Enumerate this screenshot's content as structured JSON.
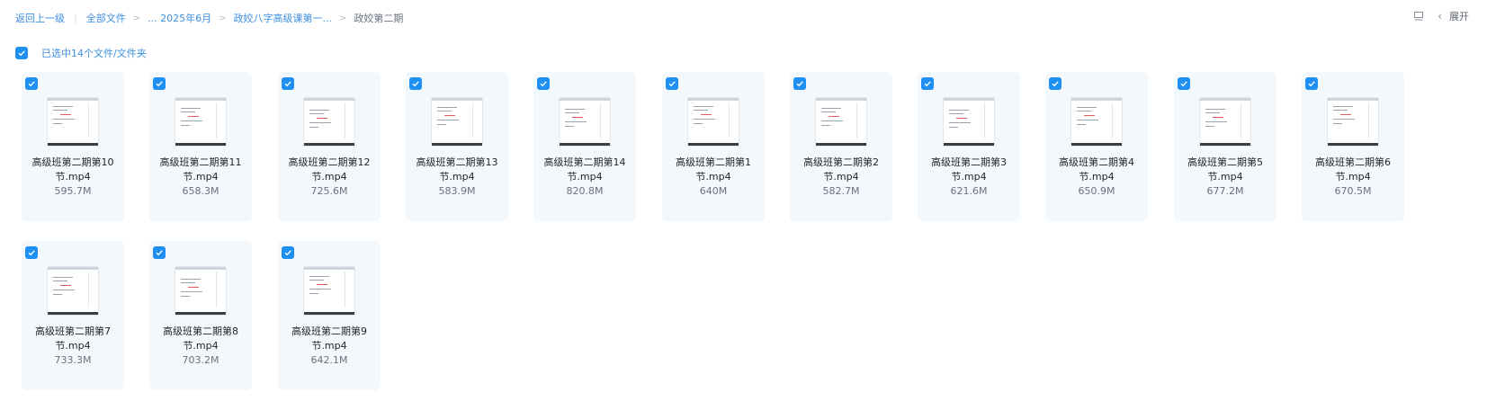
{
  "breadcrumb": {
    "back": "返回上一级",
    "root": "全部文件",
    "ellipsis_year": "... 2025年6月",
    "parent": "政姣八字高级课第一...",
    "current": "政姣第二期"
  },
  "toolbar": {
    "expand_label": "展开",
    "view_icon": "list-view-icon",
    "chevron_icon": "chevron-left-icon"
  },
  "selection": {
    "label": "已选中14个文件/文件夹",
    "checked": true
  },
  "colors": {
    "accent": "#1f8ff1",
    "link": "#3d8fe0",
    "card_bg": "#f2f8fc"
  },
  "files": [
    {
      "name_line1": "高级班第二期第10",
      "name_line2": "节.mp4",
      "size": "595.7M"
    },
    {
      "name_line1": "高级班第二期第11",
      "name_line2": "节.mp4",
      "size": "658.3M"
    },
    {
      "name_line1": "高级班第二期第12",
      "name_line2": "节.mp4",
      "size": "725.6M"
    },
    {
      "name_line1": "高级班第二期第13",
      "name_line2": "节.mp4",
      "size": "583.9M"
    },
    {
      "name_line1": "高级班第二期第14",
      "name_line2": "节.mp4",
      "size": "820.8M"
    },
    {
      "name_line1": "高级班第二期第1",
      "name_line2": "节.mp4",
      "size": "640M"
    },
    {
      "name_line1": "高级班第二期第2",
      "name_line2": "节.mp4",
      "size": "582.7M"
    },
    {
      "name_line1": "高级班第二期第3",
      "name_line2": "节.mp4",
      "size": "621.6M"
    },
    {
      "name_line1": "高级班第二期第4",
      "name_line2": "节.mp4",
      "size": "650.9M"
    },
    {
      "name_line1": "高级班第二期第5",
      "name_line2": "节.mp4",
      "size": "677.2M"
    },
    {
      "name_line1": "高级班第二期第6",
      "name_line2": "节.mp4",
      "size": "670.5M"
    },
    {
      "name_line1": "高级班第二期第7",
      "name_line2": "节.mp4",
      "size": "733.3M"
    },
    {
      "name_line1": "高级班第二期第8",
      "name_line2": "节.mp4",
      "size": "703.2M"
    },
    {
      "name_line1": "高级班第二期第9",
      "name_line2": "节.mp4",
      "size": "642.1M"
    }
  ]
}
